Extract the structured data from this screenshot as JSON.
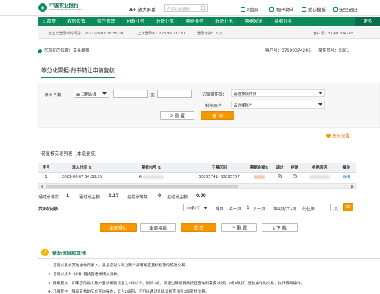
{
  "header": {
    "bank_name_cn": "中国农业银行",
    "bank_name_en": "AGRICULTURAL BANK OF CHINA",
    "font_toggle_prefix": "A+",
    "font_toggle_label": "放大屏幕",
    "search_placeholder": "产品功能搜索",
    "links": [
      "e管家",
      "商户收单",
      "爱心模板",
      "安全退出"
    ]
  },
  "nav": {
    "items": [
      "首页",
      "权限设置",
      "账户管理",
      "付款业务",
      "收款业务",
      "票据业务",
      "收款业务",
      "票据发送",
      "票据业务"
    ],
    "more": "更多"
  },
  "info": {
    "last_login": "您上次登录的时间是：2023-08-03 18:35:30",
    "last_ip": "上次登录IP：223.99.213.67",
    "login_count": "登录次数：3 次",
    "customer": "客户号：37990374245"
  },
  "location": {
    "text": "您现在的位置：交易复核",
    "customer_no": "客户号：37990374245",
    "operator_no": "操作员号：0001"
  },
  "page_title": "等分化票据-背书转让申请复核",
  "form": {
    "date_label": "录入日期：",
    "date_select": "日期选择",
    "to": "至",
    "operator_label": "记账操作员：",
    "operator_value": "请选择操作员",
    "account_label": "转出账户：",
    "account_value": "请选择账户",
    "reset": "重 置",
    "query": "查 询"
  },
  "settings_link": "表头设置",
  "list_title": "待复核交易列表（本级复核）",
  "table": {
    "headers": [
      "序号",
      "录入时间",
      "票据包号",
      "子票区间",
      "票据金额",
      "通过",
      "拒绝",
      "拒绝原因",
      "操作"
    ],
    "rows": [
      {
        "index": "1",
        "time": "2023-08-07 14:38:25",
        "package": "6",
        "range": "53095741- 53095757",
        "action": "详情"
      }
    ]
  },
  "summary": {
    "pass_count_label": "通过总笔数：",
    "pass_count": "1",
    "pass_amount_label": "通过总金额：",
    "pass_amount": "0.17",
    "reject_count_label": "拒绝总笔数：",
    "reject_count": "0",
    "reject_amount_label": "拒绝总金额：",
    "reject_amount": "0.00"
  },
  "pager": {
    "total": "共1条记录",
    "per_page": "10条/页",
    "first": "首页",
    "prev": "上一页",
    "pages": "1",
    "next": "下一页",
    "page_info": "第1页/共1页",
    "goto": "前往第",
    "page_unit": "页",
    "go": "GO"
  },
  "actions": {
    "pass_all": "全部通过",
    "reject_all": "全部拒绝",
    "submit": "提 交",
    "reset": "重 置",
    "download": "下 载"
  },
  "help": {
    "title": "帮助信息和其他",
    "items": [
      "1. 您可以复核其他操作员录入，并且您对付款方账户拥有相应复核权限的转账交易。",
      "2. 您可以点击“详情”链接查看详情并复核。",
      "3. 降级复核：如果您的最大账户复核级别设置为1级以上，例如3级，可通过降级复核按钮查询到需要2级到（或1级别）复核操作的交易，执行降级操作。",
      "4. 升级复核：降级复核的反向查询操作，既当2级别，还可以通过升级复核查询到3级复核交易。"
    ]
  },
  "colors": {
    "brand": "#0c8a5a",
    "accent": "#f39800"
  }
}
